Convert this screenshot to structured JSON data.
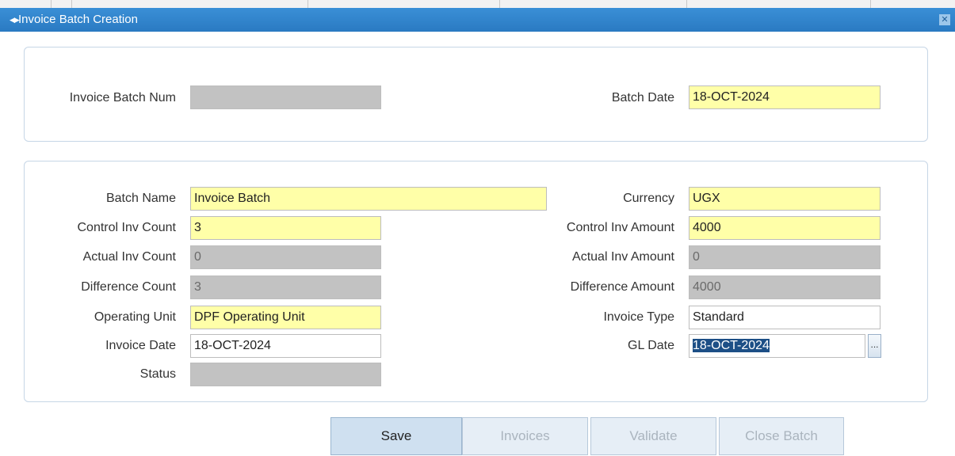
{
  "window": {
    "title": "Invoice Batch Creation",
    "title_icon": "window-arrows-icon",
    "close_icon": "close-icon"
  },
  "header_panel": {
    "invoice_batch_num": {
      "label": "Invoice Batch Num",
      "value": ""
    },
    "batch_date": {
      "label": "Batch Date",
      "value": "18-OCT-2024"
    }
  },
  "details_panel": {
    "batch_name": {
      "label": "Batch Name",
      "value": "Invoice Batch"
    },
    "currency": {
      "label": "Currency",
      "value": "UGX"
    },
    "control_inv_count": {
      "label": "Control  Inv Count",
      "value": "3"
    },
    "control_inv_amount": {
      "label": "Control  Inv Amount",
      "value": "4000"
    },
    "actual_inv_count": {
      "label": "Actual  Inv Count",
      "value": "0"
    },
    "actual_inv_amount": {
      "label": "Actual  Inv Amount",
      "value": "0"
    },
    "difference_count": {
      "label": "Difference Count",
      "value": "3"
    },
    "difference_amount": {
      "label": "Difference Amount",
      "value": "4000"
    },
    "operating_unit": {
      "label": "Operating Unit",
      "value": "DPF Operating Unit"
    },
    "invoice_type": {
      "label": "Invoice Type",
      "value": "Standard"
    },
    "invoice_date": {
      "label": "Invoice Date",
      "value": "18-OCT-2024"
    },
    "gl_date": {
      "label": "GL Date",
      "value": "18-OCT-2024",
      "lov_button": "..."
    },
    "status": {
      "label": "Status",
      "value": ""
    }
  },
  "buttons": {
    "save": "Save",
    "invoices": "Invoices",
    "validate": "Validate",
    "close_batch": "Close Batch"
  },
  "colors": {
    "title_bar": "#2a7ac2",
    "required_field": "#ffffa8",
    "readonly_field": "#c2c2c2",
    "selection": "#1d4f86"
  }
}
